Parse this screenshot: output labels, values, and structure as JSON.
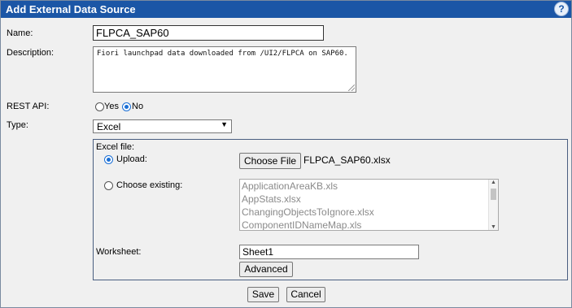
{
  "dialog": {
    "title": "Add External Data Source",
    "help_label": "?"
  },
  "form": {
    "name_label": "Name:",
    "name_value": "FLPCA_SAP60",
    "description_label": "Description:",
    "description_value": "Fiori launchpad data downloaded from /UI2/FLPCA on SAP60.",
    "rest_api_label": "REST API:",
    "rest_api_yes": "Yes",
    "rest_api_no": "No",
    "rest_api_selected": "No",
    "type_label": "Type:",
    "type_value": "Excel"
  },
  "excel": {
    "section_label": "Excel file:",
    "upload_label": "Upload:",
    "choose_file_button": "Choose File",
    "chosen_file": "FLPCA_SAP60.xlsx",
    "choose_existing_label": "Choose existing:",
    "existing_files": [
      "ApplicationAreaKB.xls",
      "AppStats.xlsx",
      "ChangingObjectsToIgnore.xlsx",
      "ComponentIDNameMap.xls"
    ],
    "worksheet_label": "Worksheet:",
    "worksheet_value": "Sheet1",
    "advanced_button": "Advanced"
  },
  "footer": {
    "save_button": "Save",
    "cancel_button": "Cancel"
  }
}
